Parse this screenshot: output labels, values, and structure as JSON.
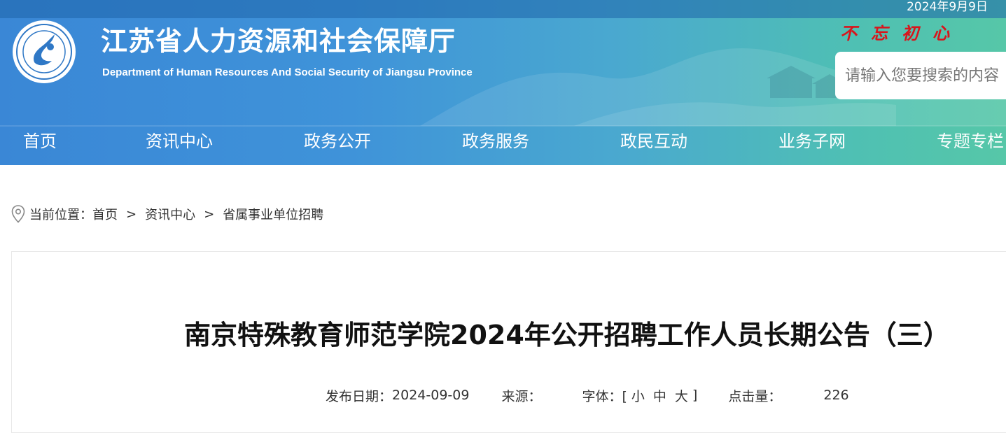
{
  "header": {
    "date": "2024年9月9日",
    "title": "江苏省人力资源和社会保障厅",
    "subtitle": "Department of Human Resources And Social Security of Jiangsu Province",
    "slogan": "不忘初心",
    "search_placeholder": "请输入您要搜索的内容"
  },
  "nav": {
    "items": [
      {
        "label": "首页"
      },
      {
        "label": "资讯中心"
      },
      {
        "label": "政务公开"
      },
      {
        "label": "政务服务"
      },
      {
        "label": "政民互动"
      },
      {
        "label": "业务子网"
      },
      {
        "label": "专题专栏"
      }
    ]
  },
  "breadcrumb": {
    "prefix": "当前位置：",
    "items": [
      "首页",
      "资讯中心",
      "省属事业单位招聘"
    ],
    "separator": ">"
  },
  "article": {
    "title": "南京特殊教育师范学院2024年公开招聘工作人员长期公告（三）",
    "meta": {
      "date_label": "发布日期：",
      "date": "2024-09-09",
      "source_label": "来源：",
      "source": "",
      "font_label": "字体：[",
      "font_small": "小",
      "font_medium": "中",
      "font_large": "大",
      "font_close": "]",
      "clicks_label": "点击量：",
      "clicks": "226"
    }
  },
  "colors": {
    "header_blue": "#3a87d6",
    "header_green": "#56c7a8",
    "slogan_red": "#d9141b"
  }
}
